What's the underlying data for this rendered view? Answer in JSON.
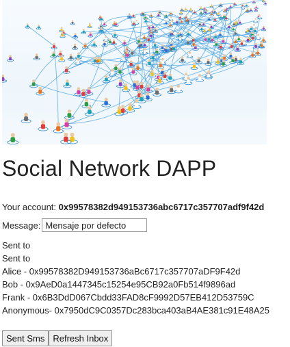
{
  "hero": {
    "image": "crowd-network-image"
  },
  "title": "Social Network DAPP",
  "account": {
    "label": "Your account: ",
    "address": "0x99578382d949153736abc6717c357707adf9f42d"
  },
  "message": {
    "label": "Message:",
    "value": "Mensaje por defecto"
  },
  "sent_lines": [
    "Sent to",
    "Sent to"
  ],
  "contacts": [
    "Alice - 0x99578382D949153736aBc6717c357707aDF9F42d",
    "Bob - 0x9AeD0a1447345c15254e95CB92a0Fb514f9896ad",
    "Frank - 0x6B3DdD067Cbdd33FAD8cF9992D57EB412D53759C",
    "Anonymous- 0x7950dC9C0357Dc283bca403aB4AE381c91E48A25"
  ],
  "buttons": {
    "send": "Sent Sms",
    "refresh": "Refresh Inbox"
  }
}
